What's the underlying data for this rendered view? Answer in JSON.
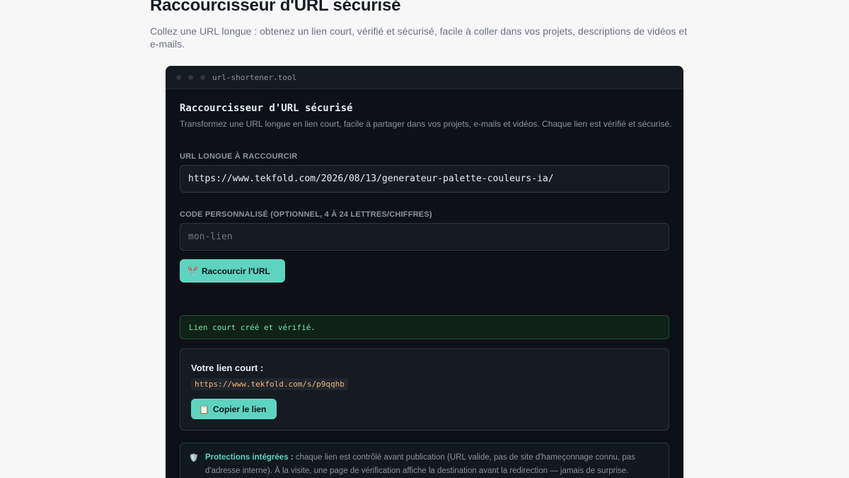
{
  "page": {
    "title": "Raccourcisseur d'URL sécurisé",
    "description": "Collez une URL longue : obtenez un lien court, vérifié et sécurisé, facile à coller dans vos projets, descriptions de vidéos et e-mails."
  },
  "window": {
    "title": "url-shortener.tool"
  },
  "tool": {
    "title": "Raccourcisseur d'URL sécurisé",
    "description": "Transformez une URL longue en lien court, facile à partager dans vos projets, e-mails et vidéos. Chaque lien est vérifié et sécurisé."
  },
  "form": {
    "url_label": "URL LONGUE À RACCOURCIR",
    "url_value": "https://www.tekfold.com/2026/08/13/generateur-palette-couleurs-ia/",
    "code_label": "CODE PERSONNALISÉ (OPTIONNEL, 4 À 24 LETTRES/CHIFFRES)",
    "code_placeholder": "mon-lien",
    "submit_icon": "✂️",
    "submit_label": "Raccourcir l'URL"
  },
  "status": {
    "message": "Lien court créé et vérifié."
  },
  "result": {
    "label": "Votre lien court :",
    "short_url": "https://www.tekfold.com/s/p9qqhb",
    "copy_icon": "📋",
    "copy_label": "Copier le lien"
  },
  "info": {
    "icon": "🛡️",
    "heading": "Protections intégrées :",
    "text": " chaque lien est contrôlé avant publication (URL valide, pas de site d'hameçonnage connu, pas d'adresse interne). À la visite, une page de vérification affiche la destination avant la redirection — jamais de surprise."
  },
  "colors": {
    "accent": "#5dd4c0",
    "window_bg": "#0d1117",
    "success": "#7ee2a8",
    "link": "#f0b27a"
  }
}
